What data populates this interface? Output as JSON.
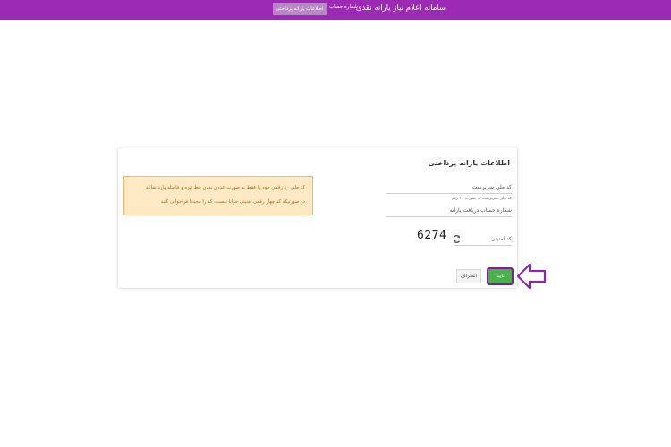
{
  "header": {
    "app_title": "سامانه اعلام نیاز یارانه نقدی",
    "nav": [
      {
        "label": "شماره حساب",
        "active": false
      },
      {
        "label": "اطلاعات یارانه پرداختی",
        "active": true
      }
    ]
  },
  "form": {
    "title": "اطلاعات یارانه پرداختی",
    "fields": {
      "national_code": {
        "label": "کد ملی سرپرست",
        "value": "",
        "hint": "کد ملی سرپرست به صورت ۱۰ رقم"
      },
      "account_number": {
        "label": "شماره حساب دریافت یارانه",
        "value": ""
      },
      "security_code": {
        "label": "کد امنیتی",
        "value": ""
      }
    },
    "captcha": {
      "code": "6274",
      "refresh_icon": "refresh-icon"
    },
    "alert": {
      "lines": [
        "کد ملی ۱۰ رقمی خود را فقط به صورت عددی بدون خط تیره و فاصله وارد نمائید",
        "در صورتیکه کد چهار رقمی امنیتی خوانا نیست، کد را مجددا فراخوانی کنید"
      ]
    },
    "buttons": {
      "confirm": "تایید",
      "cancel": "انصراف"
    }
  },
  "colors": {
    "header_bg": "#9c2ab4",
    "active_tab_bg": "#b887c6",
    "confirm_button": "#4cae4f",
    "highlight": "#7d1d97",
    "alert_bg": "#fde9c4",
    "alert_border": "#f0b56a",
    "alert_text": "#b4661e"
  },
  "annotation": {
    "pointer_icon": "arrow-left-outline-icon"
  }
}
